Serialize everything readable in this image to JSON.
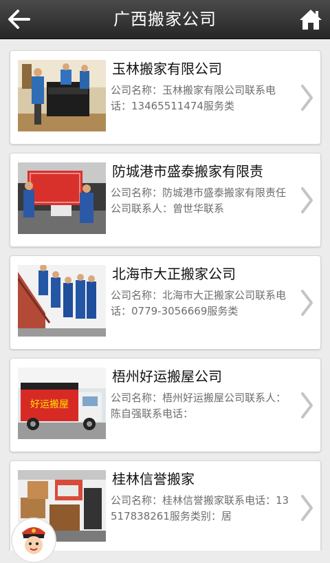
{
  "header": {
    "title": "广西搬家公司",
    "back_icon": "back-arrow-icon",
    "home_icon": "home-icon"
  },
  "colors": {
    "header_bg": "#333333",
    "page_bg": "#ececec",
    "card_bg": "#ffffff",
    "desc_text": "#6d6d6d"
  },
  "companies": [
    {
      "name": "玉林搬家有限公司",
      "desc": "公司名称：玉林搬家有限公司联系电话：13465511474服务类"
    },
    {
      "name": "防城港市盛泰搬家有限责",
      "desc": "公司名称：防城港市盛泰搬家有限责任公司联系人：曾世华联系"
    },
    {
      "name": "北海市大正搬家公司",
      "desc": "公司名称：北海市大正搬家公司联系电话：0779-3056669服务类"
    },
    {
      "name": "梧州好运搬屋公司",
      "desc": "公司名称：梧州好运搬屋公司联系人：陈自强联系电话：",
      "truck_sign": "好运搬屋"
    },
    {
      "name": "桂林信誉搬家",
      "desc": "公司名称：桂林信誉搬家联系电话：13517838261服务类别：居"
    }
  ]
}
